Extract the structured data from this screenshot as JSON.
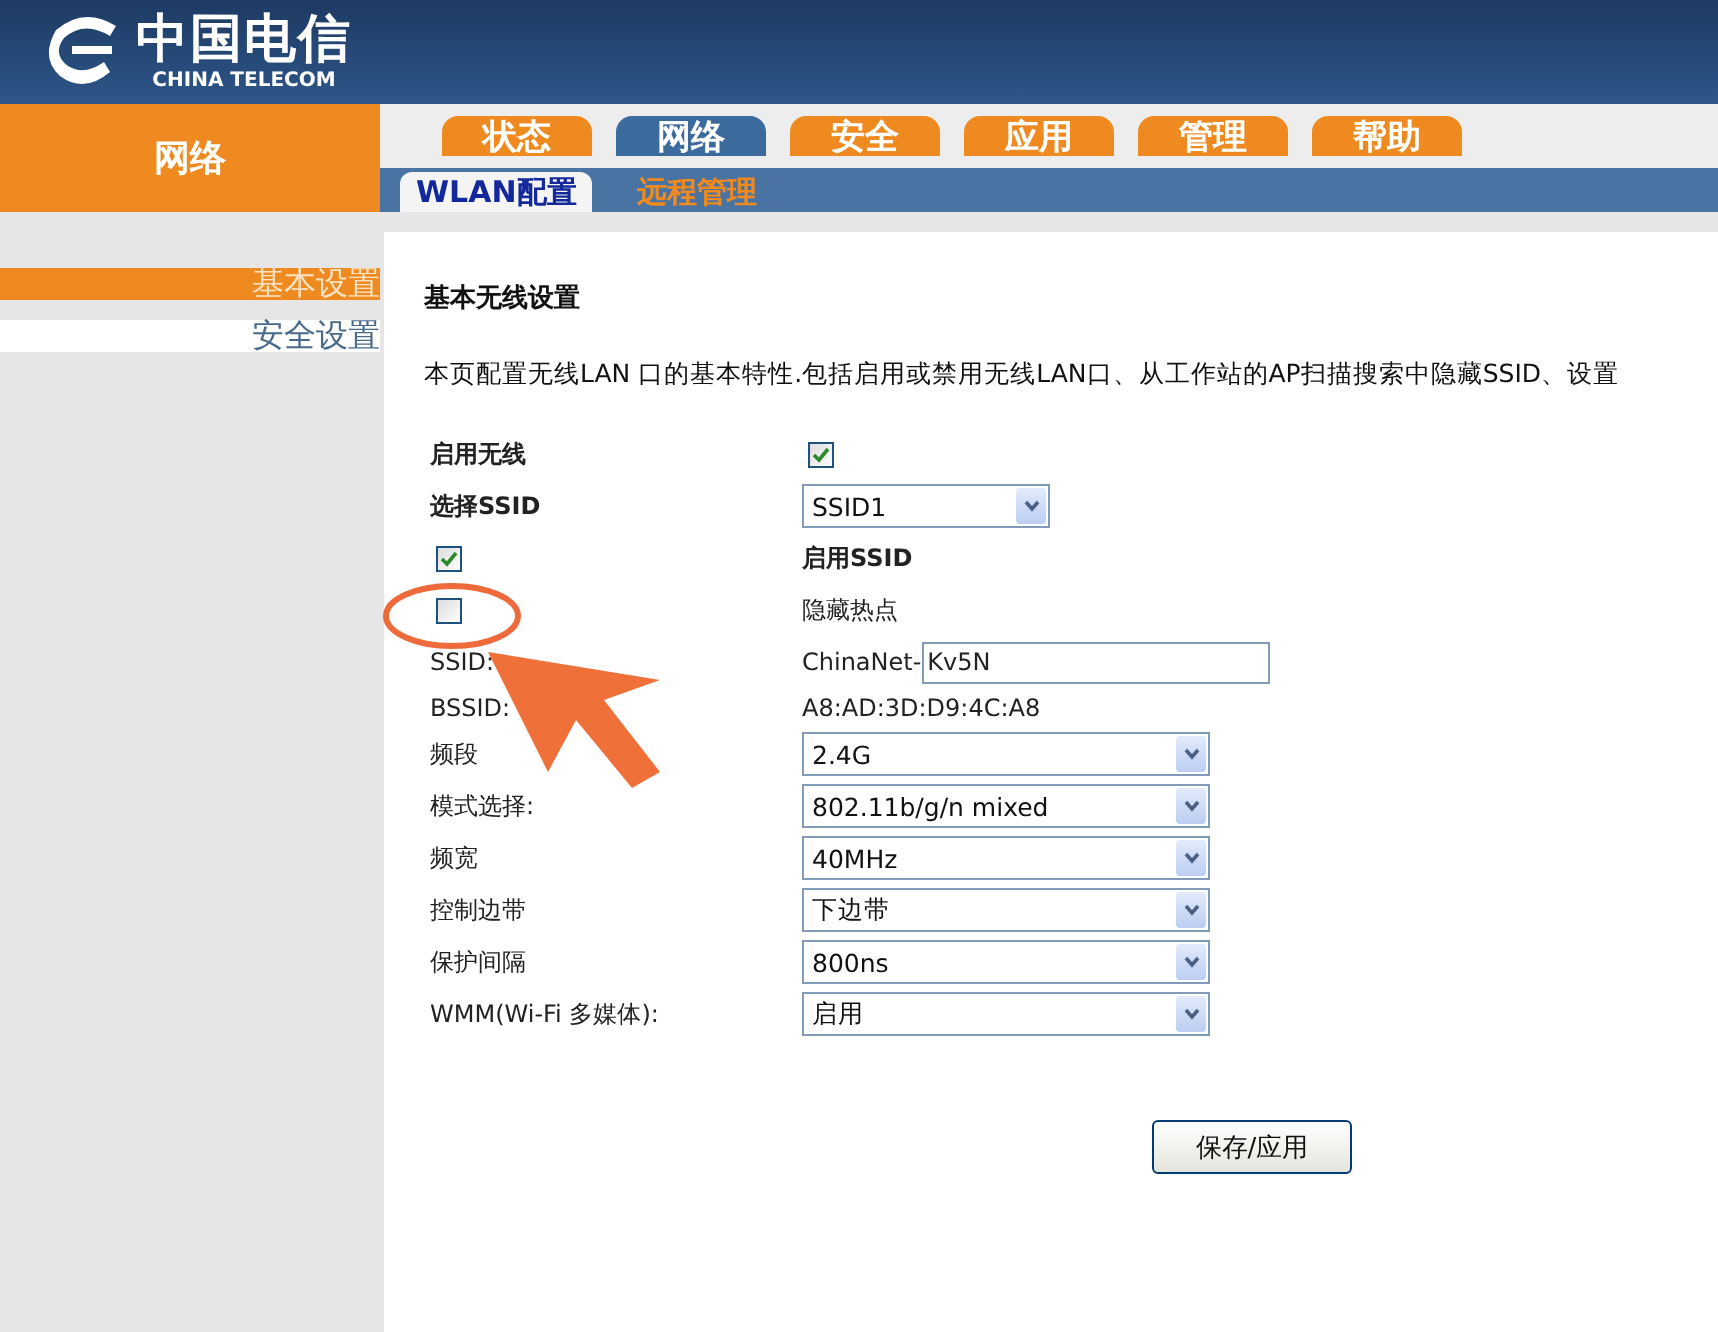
{
  "header": {
    "logo_cn": "中国电信",
    "logo_en": "CHINA TELECOM"
  },
  "section_title": "网络",
  "tabs": [
    {
      "label": "状态",
      "selected": false
    },
    {
      "label": "网络",
      "selected": true
    },
    {
      "label": "安全",
      "selected": false
    },
    {
      "label": "应用",
      "selected": false
    },
    {
      "label": "管理",
      "selected": false
    },
    {
      "label": "帮助",
      "selected": false
    }
  ],
  "subtabs": [
    {
      "label": "WLAN配置",
      "selected": true
    },
    {
      "label": "远程管理",
      "selected": false
    }
  ],
  "sidebar": {
    "items": [
      {
        "label": "基本设置",
        "selected": true
      },
      {
        "label": "安全设置",
        "selected": false
      }
    ]
  },
  "form": {
    "title": "基本无线设置",
    "description": "本页配置无线LAN 口的基本特性.包括启用或禁用无线LAN口、从工作站的AP扫描搜索中隐藏SSID、设置",
    "rows": [
      {
        "kind": "checkbox",
        "label": "启用无线",
        "bold": true,
        "checked": true
      },
      {
        "kind": "select",
        "label": "选择SSID",
        "bold": true,
        "value": "SSID1",
        "short": true
      },
      {
        "kind": "check_left",
        "label": "启用SSID",
        "bold": true,
        "checked": true
      },
      {
        "kind": "check_left",
        "label": "隐藏热点",
        "bold": false,
        "checked": false
      },
      {
        "kind": "text_field",
        "label": "SSID:",
        "prefix": "ChinaNet-",
        "value": "Kv5N"
      },
      {
        "kind": "text",
        "label": "BSSID:",
        "value": "A8:AD:3D:D9:4C:A8"
      },
      {
        "kind": "select",
        "label": "频段",
        "value": "2.4G"
      },
      {
        "kind": "select",
        "label": "模式选择:",
        "value": "802.11b/g/n mixed"
      },
      {
        "kind": "select",
        "label": "频宽",
        "value": "40MHz"
      },
      {
        "kind": "select",
        "label": "控制边带",
        "value": "下边带"
      },
      {
        "kind": "select",
        "label": "保护间隔",
        "value": "800ns"
      },
      {
        "kind": "select",
        "label": "WMM(Wi-Fi 多媒体):",
        "value": "启用"
      }
    ],
    "button": "保存/应用"
  }
}
